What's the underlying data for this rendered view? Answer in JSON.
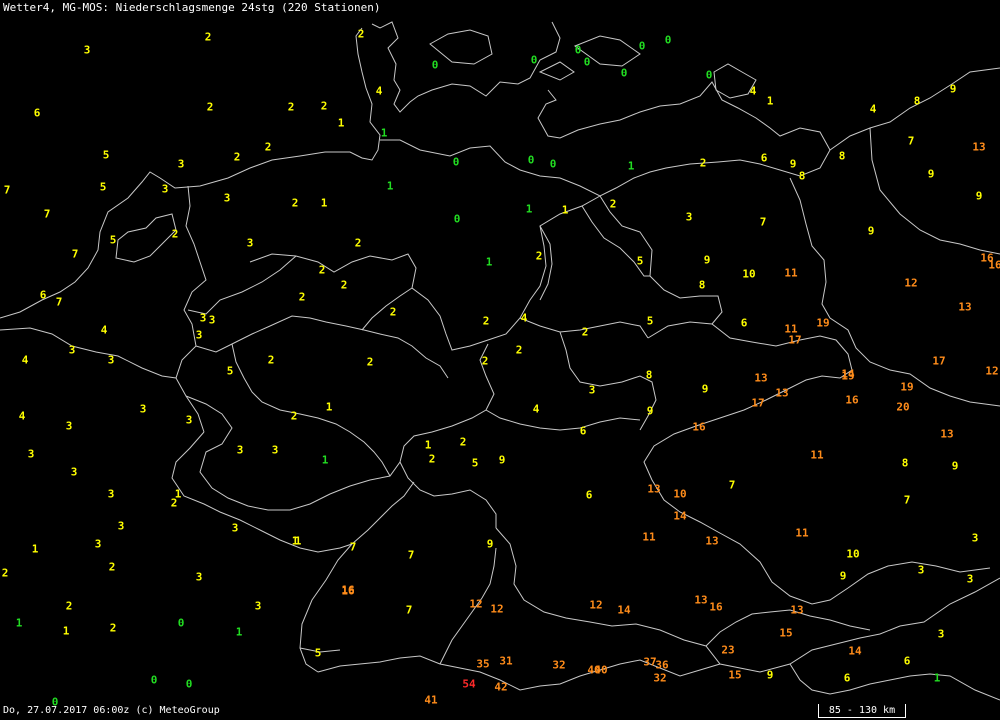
{
  "header": {
    "title": "Wetter4, MG-MOS: Niederschlagsmenge 24stg (220 Stationen)"
  },
  "footer": {
    "timestamp": "Do, 27.07.2017 06:00z (c) MeteoGroup"
  },
  "scale_bar": {
    "label": "85 - 130 km"
  },
  "colors": {
    "c0": "#22dd22",
    "c1": "#ffff00",
    "c2": "#ff8c1a",
    "c3": "#ff2a2a"
  },
  "stations": [
    {
      "v": "2",
      "c": "c1"
    },
    {
      "v": "3",
      "c": "c1"
    },
    {
      "v": "2",
      "c": "c1"
    },
    {
      "v": "0",
      "c": "c0"
    },
    {
      "v": "0",
      "c": "c0"
    },
    {
      "v": "0",
      "c": "c0"
    },
    {
      "v": "0",
      "c": "c0"
    },
    {
      "v": "0",
      "c": "c0"
    },
    {
      "v": "0",
      "c": "c0"
    },
    {
      "v": "0",
      "c": "c0"
    },
    {
      "v": "6",
      "c": "c1"
    },
    {
      "v": "2",
      "c": "c1"
    },
    {
      "v": "2",
      "c": "c1"
    },
    {
      "v": "2",
      "c": "c1"
    },
    {
      "v": "4",
      "c": "c1"
    },
    {
      "v": "0",
      "c": "c0"
    },
    {
      "v": "4",
      "c": "c1"
    },
    {
      "v": "1",
      "c": "c1"
    },
    {
      "v": "9",
      "c": "c1"
    },
    {
      "v": "8",
      "c": "c1"
    },
    {
      "v": "4",
      "c": "c1"
    },
    {
      "v": "1",
      "c": "c1"
    },
    {
      "v": "1",
      "c": "c0"
    },
    {
      "v": "5",
      "c": "c1"
    },
    {
      "v": "3",
      "c": "c1"
    },
    {
      "v": "2",
      "c": "c1"
    },
    {
      "v": "2",
      "c": "c1"
    },
    {
      "v": "0",
      "c": "c0"
    },
    {
      "v": "0",
      "c": "c0"
    },
    {
      "v": "0",
      "c": "c0"
    },
    {
      "v": "1",
      "c": "c0"
    },
    {
      "v": "2",
      "c": "c1"
    },
    {
      "v": "6",
      "c": "c1"
    },
    {
      "v": "9",
      "c": "c1"
    },
    {
      "v": "8",
      "c": "c1"
    },
    {
      "v": "7",
      "c": "c1"
    },
    {
      "v": "13",
      "c": "c2"
    },
    {
      "v": "7",
      "c": "c1"
    },
    {
      "v": "5",
      "c": "c1"
    },
    {
      "v": "3",
      "c": "c1"
    },
    {
      "v": "3",
      "c": "c1"
    },
    {
      "v": "2",
      "c": "c1"
    },
    {
      "v": "1",
      "c": "c1"
    },
    {
      "v": "1",
      "c": "c0"
    },
    {
      "v": "8",
      "c": "c1"
    },
    {
      "v": "9",
      "c": "c1"
    },
    {
      "v": "9",
      "c": "c1"
    },
    {
      "v": "7",
      "c": "c1"
    },
    {
      "v": "0",
      "c": "c0"
    },
    {
      "v": "1",
      "c": "c0"
    },
    {
      "v": "1",
      "c": "c1"
    },
    {
      "v": "2",
      "c": "c1"
    },
    {
      "v": "3",
      "c": "c1"
    },
    {
      "v": "7",
      "c": "c1"
    },
    {
      "v": "5",
      "c": "c1"
    },
    {
      "v": "2",
      "c": "c1"
    },
    {
      "v": "3",
      "c": "c1"
    },
    {
      "v": "2",
      "c": "c1"
    },
    {
      "v": "7",
      "c": "c1"
    },
    {
      "v": "1",
      "c": "c0"
    },
    {
      "v": "2",
      "c": "c1"
    },
    {
      "v": "5",
      "c": "c1"
    },
    {
      "v": "9",
      "c": "c1"
    },
    {
      "v": "10",
      "c": "c1"
    },
    {
      "v": "11",
      "c": "c2"
    },
    {
      "v": "9",
      "c": "c1"
    },
    {
      "v": "16",
      "c": "c2"
    },
    {
      "v": "16",
      "c": "c2"
    },
    {
      "v": "6",
      "c": "c1"
    },
    {
      "v": "7",
      "c": "c1"
    },
    {
      "v": "2",
      "c": "c1"
    },
    {
      "v": "2",
      "c": "c1"
    },
    {
      "v": "2",
      "c": "c1"
    },
    {
      "v": "8",
      "c": "c1"
    },
    {
      "v": "12",
      "c": "c2"
    },
    {
      "v": "13",
      "c": "c2"
    },
    {
      "v": "3",
      "c": "c1"
    },
    {
      "v": "3",
      "c": "c1"
    },
    {
      "v": "2",
      "c": "c1"
    },
    {
      "v": "2",
      "c": "c1"
    },
    {
      "v": "4",
      "c": "c1"
    },
    {
      "v": "5",
      "c": "c1"
    },
    {
      "v": "4",
      "c": "c1"
    },
    {
      "v": "3",
      "c": "c1"
    },
    {
      "v": "2",
      "c": "c1"
    },
    {
      "v": "6",
      "c": "c1"
    },
    {
      "v": "11",
      "c": "c2"
    },
    {
      "v": "19",
      "c": "c2"
    },
    {
      "v": "17",
      "c": "c2"
    },
    {
      "v": "17",
      "c": "c2"
    },
    {
      "v": "3",
      "c": "c1"
    },
    {
      "v": "2",
      "c": "c1"
    },
    {
      "v": "2",
      "c": "c1"
    },
    {
      "v": "2",
      "c": "c1"
    },
    {
      "v": "13",
      "c": "c2"
    },
    {
      "v": "12",
      "c": "c2"
    },
    {
      "v": "4",
      "c": "c1"
    },
    {
      "v": "3",
      "c": "c1"
    },
    {
      "v": "2",
      "c": "c1"
    },
    {
      "v": "5",
      "c": "c1"
    },
    {
      "v": "8",
      "c": "c1"
    },
    {
      "v": "9",
      "c": "c1"
    },
    {
      "v": "13",
      "c": "c2"
    },
    {
      "v": "14",
      "c": "c2"
    },
    {
      "v": "19",
      "c": "c2"
    },
    {
      "v": "19",
      "c": "c2"
    },
    {
      "v": "3",
      "c": "c1"
    },
    {
      "v": "4",
      "c": "c1"
    },
    {
      "v": "3",
      "c": "c1"
    },
    {
      "v": "1",
      "c": "c1"
    },
    {
      "v": "4",
      "c": "c1"
    },
    {
      "v": "9",
      "c": "c1"
    },
    {
      "v": "17",
      "c": "c2"
    },
    {
      "v": "16",
      "c": "c2"
    },
    {
      "v": "20",
      "c": "c2"
    },
    {
      "v": "3",
      "c": "c1"
    },
    {
      "v": "3",
      "c": "c1"
    },
    {
      "v": "2",
      "c": "c1"
    },
    {
      "v": "6",
      "c": "c1"
    },
    {
      "v": "16",
      "c": "c2"
    },
    {
      "v": "13",
      "c": "c2"
    },
    {
      "v": "3",
      "c": "c1"
    },
    {
      "v": "1",
      "c": "c1"
    },
    {
      "v": "2",
      "c": "c1"
    },
    {
      "v": "1",
      "c": "c0"
    },
    {
      "v": "3",
      "c": "c1"
    },
    {
      "v": "3",
      "c": "c1"
    },
    {
      "v": "11",
      "c": "c2"
    },
    {
      "v": "8",
      "c": "c1"
    },
    {
      "v": "9",
      "c": "c1"
    },
    {
      "v": "3",
      "c": "c1"
    },
    {
      "v": "1",
      "c": "c1"
    },
    {
      "v": "2",
      "c": "c1"
    },
    {
      "v": "5",
      "c": "c1"
    },
    {
      "v": "9",
      "c": "c1"
    },
    {
      "v": "13",
      "c": "c2"
    },
    {
      "v": "10",
      "c": "c2"
    },
    {
      "v": "7",
      "c": "c1"
    },
    {
      "v": "7",
      "c": "c1"
    },
    {
      "v": "14",
      "c": "c2"
    },
    {
      "v": "3",
      "c": "c1"
    },
    {
      "v": "2",
      "c": "c1"
    },
    {
      "v": "1",
      "c": "c1"
    },
    {
      "v": "3",
      "c": "c1"
    },
    {
      "v": "6",
      "c": "c1"
    },
    {
      "v": "11",
      "c": "c2"
    },
    {
      "v": "13",
      "c": "c2"
    },
    {
      "v": "11",
      "c": "c2"
    },
    {
      "v": "3",
      "c": "c1"
    },
    {
      "v": "1",
      "c": "c1"
    },
    {
      "v": "3",
      "c": "c1"
    },
    {
      "v": "3",
      "c": "c1"
    },
    {
      "v": "7",
      "c": "c1"
    },
    {
      "v": "9",
      "c": "c1"
    },
    {
      "v": "10",
      "c": "c1"
    },
    {
      "v": "2",
      "c": "c1"
    },
    {
      "v": "2",
      "c": "c1"
    },
    {
      "v": "16",
      "c": "c2"
    },
    {
      "v": "9",
      "c": "c1"
    },
    {
      "v": "3",
      "c": "c1"
    },
    {
      "v": "3",
      "c": "c1"
    },
    {
      "v": "1",
      "c": "c1"
    },
    {
      "v": "3",
      "c": "c1"
    },
    {
      "v": "2",
      "c": "c1"
    },
    {
      "v": "3",
      "c": "c1"
    },
    {
      "v": "7",
      "c": "c1"
    },
    {
      "v": "12",
      "c": "c2"
    },
    {
      "v": "12",
      "c": "c2"
    },
    {
      "v": "12",
      "c": "c2"
    },
    {
      "v": "14",
      "c": "c2"
    },
    {
      "v": "13",
      "c": "c2"
    },
    {
      "v": "16",
      "c": "c2"
    },
    {
      "v": "13",
      "c": "c2"
    },
    {
      "v": "1",
      "c": "c0"
    },
    {
      "v": "1",
      "c": "c1"
    },
    {
      "v": "2",
      "c": "c1"
    },
    {
      "v": "0",
      "c": "c0"
    },
    {
      "v": "1",
      "c": "c0"
    },
    {
      "v": "15",
      "c": "c2"
    },
    {
      "v": "3",
      "c": "c1"
    },
    {
      "v": "5",
      "c": "c1"
    },
    {
      "v": "7",
      "c": "c1"
    },
    {
      "v": "16",
      "c": "c2"
    },
    {
      "v": "35",
      "c": "c2"
    },
    {
      "v": "31",
      "c": "c2"
    },
    {
      "v": "32",
      "c": "c2"
    },
    {
      "v": "40",
      "c": "c2"
    },
    {
      "v": "40",
      "c": "c2"
    },
    {
      "v": "37",
      "c": "c2"
    },
    {
      "v": "36",
      "c": "c2"
    },
    {
      "v": "23",
      "c": "c2"
    },
    {
      "v": "14",
      "c": "c2"
    },
    {
      "v": "6",
      "c": "c1"
    },
    {
      "v": "1",
      "c": "c0"
    },
    {
      "v": "0",
      "c": "c0"
    },
    {
      "v": "0",
      "c": "c0"
    },
    {
      "v": "54",
      "c": "c3"
    },
    {
      "v": "42",
      "c": "c2"
    },
    {
      "v": "32",
      "c": "c2"
    },
    {
      "v": "15",
      "c": "c2"
    },
    {
      "v": "9",
      "c": "c1"
    },
    {
      "v": "6",
      "c": "c1"
    },
    {
      "v": "0",
      "c": "c0"
    },
    {
      "v": "41",
      "c": "c2"
    }
  ]
}
